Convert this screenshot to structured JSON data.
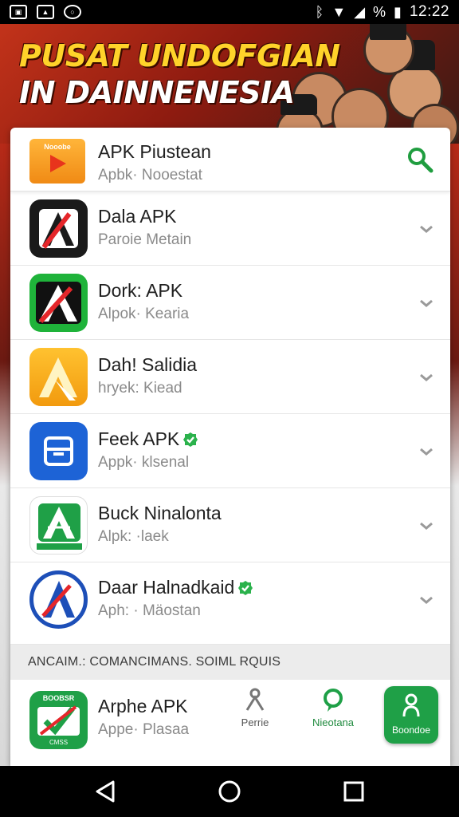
{
  "status_bar": {
    "time": "12:22",
    "battery_percent": "%",
    "left_icons": [
      "image-icon",
      "gallery-icon",
      "sync-icon"
    ]
  },
  "banner": {
    "line1": "PUSAT UNDOFGIAN",
    "line2": "IN DAINNENESIA"
  },
  "search": {
    "logo_text": "Nooobe",
    "title": "APK Piustean",
    "subtitle": "Apbk· Nooestat"
  },
  "apps": [
    {
      "name": "Dala APK",
      "sub": "Paroie Metain",
      "verified": false
    },
    {
      "name": "Dork: APK",
      "sub": "Alpok· Kearia",
      "verified": false
    },
    {
      "name": "Dah! Salidia",
      "sub": "hryek: Kiead",
      "verified": false
    },
    {
      "name": "Feek APK",
      "sub": "Appk· klsenal",
      "verified": true
    },
    {
      "name": "Buck Ninalonta",
      "sub": "Alpk: ·laek",
      "verified": false
    },
    {
      "name": "Daar Halnadkaid",
      "sub": "Aph: · Mäostan",
      "verified": true
    }
  ],
  "section": {
    "heading": "ANCAIM.: COMANCIMANS. SOIML RQUIS"
  },
  "bottom": {
    "icon_text": "BOOBSR",
    "icon_caption": "CMSS",
    "name": "Arphe APK",
    "sub": "Appe· Plasaa",
    "action1": "Perrie",
    "action2": "Nieotana",
    "action3": "Boondoe"
  },
  "colors": {
    "accent_green": "#1fa047",
    "search_green": "#1f9d3f",
    "banner_red": "#c2331a",
    "banner_yellow": "#ffd32a"
  }
}
